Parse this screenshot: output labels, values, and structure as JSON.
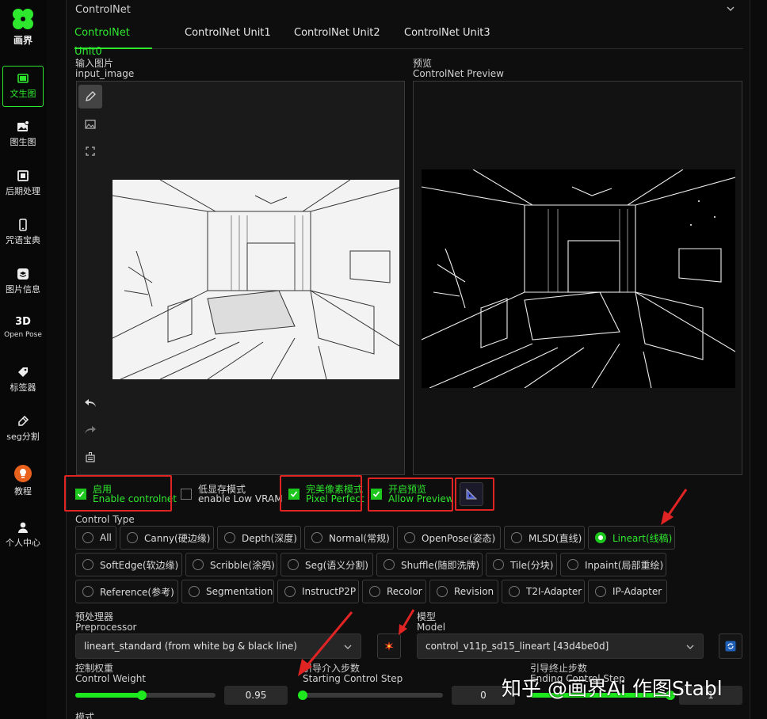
{
  "colors": {
    "accent": "#2ee82e",
    "annotation": "#e02424",
    "panel_bg": "#0e0e0e"
  },
  "sidebar": {
    "logo_text": "画界",
    "items": [
      {
        "label": "文生图",
        "icon": "image-card-icon",
        "active": true
      },
      {
        "label": "图生图",
        "icon": "image-add-icon"
      },
      {
        "label": "后期处理",
        "icon": "postprocess-icon"
      },
      {
        "label": "咒语宝典",
        "icon": "phone-book-icon"
      },
      {
        "label": "图片信息",
        "icon": "stack-icon"
      },
      {
        "label": "Open Pose",
        "icon": "3d-icon",
        "prefix": "3D"
      },
      {
        "label": "标签器",
        "icon": "tag-icon"
      },
      {
        "label": "seg分割",
        "icon": "brush-icon"
      },
      {
        "label": "教程",
        "icon": "bulb-icon"
      },
      {
        "label": "个人中心",
        "icon": "user-icon"
      }
    ]
  },
  "section_title": "ControlNet",
  "tabs": [
    "ControlNet Unit0",
    "ControlNet Unit1",
    "ControlNet Unit2",
    "ControlNet Unit3"
  ],
  "input_image": {
    "label_cn": "输入图片",
    "label_en": "input_image"
  },
  "preview": {
    "label_cn": "预览",
    "label_en": "ControlNet Preview"
  },
  "options": {
    "enable": {
      "cn": "启用",
      "en": "Enable controlnet",
      "checked": true
    },
    "low_vram": {
      "cn": "低显存模式",
      "en": "enable Low VRAM",
      "checked": false
    },
    "pixel_perfect": {
      "cn": "完美像素模式",
      "en": "Pixel Perfect",
      "checked": true
    },
    "allow_preview": {
      "cn": "开启预览",
      "en": "Allow Preview",
      "checked": true
    }
  },
  "control_type": {
    "label": "Control Type",
    "options": [
      "All",
      "Canny(硬边缘)",
      "Depth(深度)",
      "Normal(常规)",
      "OpenPose(姿态)",
      "MLSD(直线)",
      "Lineart(线稿)",
      "SoftEdge(软边缘)",
      "Scribble(涂鸦)",
      "Seg(语义分割)",
      "Shuffle(随即洗牌)",
      "Tile(分块)",
      "Inpaint(局部重绘)",
      "Reference(参考)",
      "Segmentation",
      "InstructP2P",
      "Recolor",
      "Revision",
      "T2I-Adapter",
      "IP-Adapter"
    ],
    "selected": "Lineart(线稿)"
  },
  "preprocessor": {
    "label_cn": "预处理器",
    "label_en": "Preprocessor",
    "value": "lineart_standard (from white bg & black line)"
  },
  "model": {
    "label_cn": "模型",
    "label_en": "Model",
    "value": "control_v11p_sd15_lineart [43d4be0d]"
  },
  "control_weight": {
    "label_cn": "控制权重",
    "label_en": "Control Weight",
    "value": "0.95",
    "fraction": 0.475
  },
  "start_step": {
    "label_cn": "引导介入步数",
    "label_en": "Starting Control Step",
    "value": "0",
    "fraction": 0
  },
  "end_step": {
    "label_cn": "引导终止步数",
    "label_en": "Ending Control Step",
    "value": "1",
    "fraction": 1
  },
  "bottom_label": "模式",
  "watermark": "知乎 @画界Ai 作图Stabl"
}
